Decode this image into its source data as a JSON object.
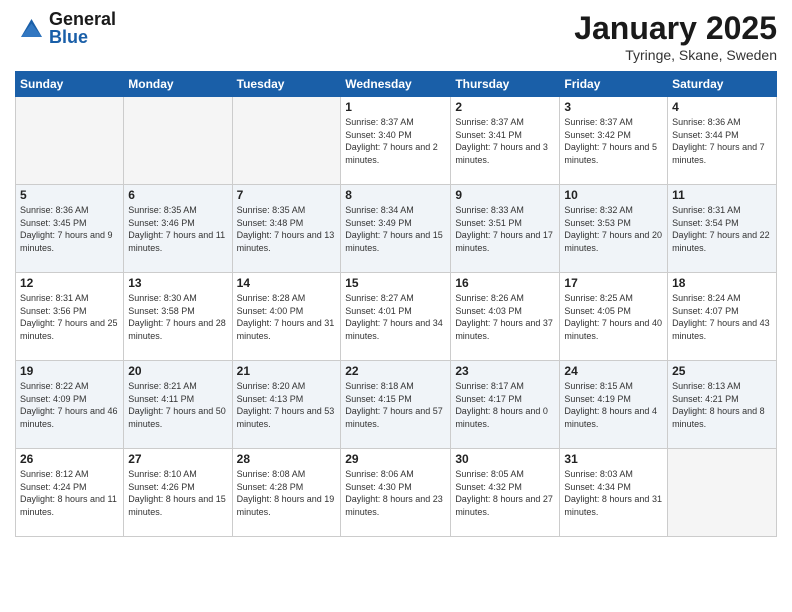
{
  "header": {
    "logo_general": "General",
    "logo_blue": "Blue",
    "month_title": "January 2025",
    "subtitle": "Tyringe, Skane, Sweden"
  },
  "days_of_week": [
    "Sunday",
    "Monday",
    "Tuesday",
    "Wednesday",
    "Thursday",
    "Friday",
    "Saturday"
  ],
  "weeks": [
    [
      {
        "num": "",
        "sunrise": "",
        "sunset": "",
        "daylight": ""
      },
      {
        "num": "",
        "sunrise": "",
        "sunset": "",
        "daylight": ""
      },
      {
        "num": "",
        "sunrise": "",
        "sunset": "",
        "daylight": ""
      },
      {
        "num": "1",
        "sunrise": "Sunrise: 8:37 AM",
        "sunset": "Sunset: 3:40 PM",
        "daylight": "Daylight: 7 hours and 2 minutes."
      },
      {
        "num": "2",
        "sunrise": "Sunrise: 8:37 AM",
        "sunset": "Sunset: 3:41 PM",
        "daylight": "Daylight: 7 hours and 3 minutes."
      },
      {
        "num": "3",
        "sunrise": "Sunrise: 8:37 AM",
        "sunset": "Sunset: 3:42 PM",
        "daylight": "Daylight: 7 hours and 5 minutes."
      },
      {
        "num": "4",
        "sunrise": "Sunrise: 8:36 AM",
        "sunset": "Sunset: 3:44 PM",
        "daylight": "Daylight: 7 hours and 7 minutes."
      }
    ],
    [
      {
        "num": "5",
        "sunrise": "Sunrise: 8:36 AM",
        "sunset": "Sunset: 3:45 PM",
        "daylight": "Daylight: 7 hours and 9 minutes."
      },
      {
        "num": "6",
        "sunrise": "Sunrise: 8:35 AM",
        "sunset": "Sunset: 3:46 PM",
        "daylight": "Daylight: 7 hours and 11 minutes."
      },
      {
        "num": "7",
        "sunrise": "Sunrise: 8:35 AM",
        "sunset": "Sunset: 3:48 PM",
        "daylight": "Daylight: 7 hours and 13 minutes."
      },
      {
        "num": "8",
        "sunrise": "Sunrise: 8:34 AM",
        "sunset": "Sunset: 3:49 PM",
        "daylight": "Daylight: 7 hours and 15 minutes."
      },
      {
        "num": "9",
        "sunrise": "Sunrise: 8:33 AM",
        "sunset": "Sunset: 3:51 PM",
        "daylight": "Daylight: 7 hours and 17 minutes."
      },
      {
        "num": "10",
        "sunrise": "Sunrise: 8:32 AM",
        "sunset": "Sunset: 3:53 PM",
        "daylight": "Daylight: 7 hours and 20 minutes."
      },
      {
        "num": "11",
        "sunrise": "Sunrise: 8:31 AM",
        "sunset": "Sunset: 3:54 PM",
        "daylight": "Daylight: 7 hours and 22 minutes."
      }
    ],
    [
      {
        "num": "12",
        "sunrise": "Sunrise: 8:31 AM",
        "sunset": "Sunset: 3:56 PM",
        "daylight": "Daylight: 7 hours and 25 minutes."
      },
      {
        "num": "13",
        "sunrise": "Sunrise: 8:30 AM",
        "sunset": "Sunset: 3:58 PM",
        "daylight": "Daylight: 7 hours and 28 minutes."
      },
      {
        "num": "14",
        "sunrise": "Sunrise: 8:28 AM",
        "sunset": "Sunset: 4:00 PM",
        "daylight": "Daylight: 7 hours and 31 minutes."
      },
      {
        "num": "15",
        "sunrise": "Sunrise: 8:27 AM",
        "sunset": "Sunset: 4:01 PM",
        "daylight": "Daylight: 7 hours and 34 minutes."
      },
      {
        "num": "16",
        "sunrise": "Sunrise: 8:26 AM",
        "sunset": "Sunset: 4:03 PM",
        "daylight": "Daylight: 7 hours and 37 minutes."
      },
      {
        "num": "17",
        "sunrise": "Sunrise: 8:25 AM",
        "sunset": "Sunset: 4:05 PM",
        "daylight": "Daylight: 7 hours and 40 minutes."
      },
      {
        "num": "18",
        "sunrise": "Sunrise: 8:24 AM",
        "sunset": "Sunset: 4:07 PM",
        "daylight": "Daylight: 7 hours and 43 minutes."
      }
    ],
    [
      {
        "num": "19",
        "sunrise": "Sunrise: 8:22 AM",
        "sunset": "Sunset: 4:09 PM",
        "daylight": "Daylight: 7 hours and 46 minutes."
      },
      {
        "num": "20",
        "sunrise": "Sunrise: 8:21 AM",
        "sunset": "Sunset: 4:11 PM",
        "daylight": "Daylight: 7 hours and 50 minutes."
      },
      {
        "num": "21",
        "sunrise": "Sunrise: 8:20 AM",
        "sunset": "Sunset: 4:13 PM",
        "daylight": "Daylight: 7 hours and 53 minutes."
      },
      {
        "num": "22",
        "sunrise": "Sunrise: 8:18 AM",
        "sunset": "Sunset: 4:15 PM",
        "daylight": "Daylight: 7 hours and 57 minutes."
      },
      {
        "num": "23",
        "sunrise": "Sunrise: 8:17 AM",
        "sunset": "Sunset: 4:17 PM",
        "daylight": "Daylight: 8 hours and 0 minutes."
      },
      {
        "num": "24",
        "sunrise": "Sunrise: 8:15 AM",
        "sunset": "Sunset: 4:19 PM",
        "daylight": "Daylight: 8 hours and 4 minutes."
      },
      {
        "num": "25",
        "sunrise": "Sunrise: 8:13 AM",
        "sunset": "Sunset: 4:21 PM",
        "daylight": "Daylight: 8 hours and 8 minutes."
      }
    ],
    [
      {
        "num": "26",
        "sunrise": "Sunrise: 8:12 AM",
        "sunset": "Sunset: 4:24 PM",
        "daylight": "Daylight: 8 hours and 11 minutes."
      },
      {
        "num": "27",
        "sunrise": "Sunrise: 8:10 AM",
        "sunset": "Sunset: 4:26 PM",
        "daylight": "Daylight: 8 hours and 15 minutes."
      },
      {
        "num": "28",
        "sunrise": "Sunrise: 8:08 AM",
        "sunset": "Sunset: 4:28 PM",
        "daylight": "Daylight: 8 hours and 19 minutes."
      },
      {
        "num": "29",
        "sunrise": "Sunrise: 8:06 AM",
        "sunset": "Sunset: 4:30 PM",
        "daylight": "Daylight: 8 hours and 23 minutes."
      },
      {
        "num": "30",
        "sunrise": "Sunrise: 8:05 AM",
        "sunset": "Sunset: 4:32 PM",
        "daylight": "Daylight: 8 hours and 27 minutes."
      },
      {
        "num": "31",
        "sunrise": "Sunrise: 8:03 AM",
        "sunset": "Sunset: 4:34 PM",
        "daylight": "Daylight: 8 hours and 31 minutes."
      },
      {
        "num": "",
        "sunrise": "",
        "sunset": "",
        "daylight": ""
      }
    ]
  ]
}
